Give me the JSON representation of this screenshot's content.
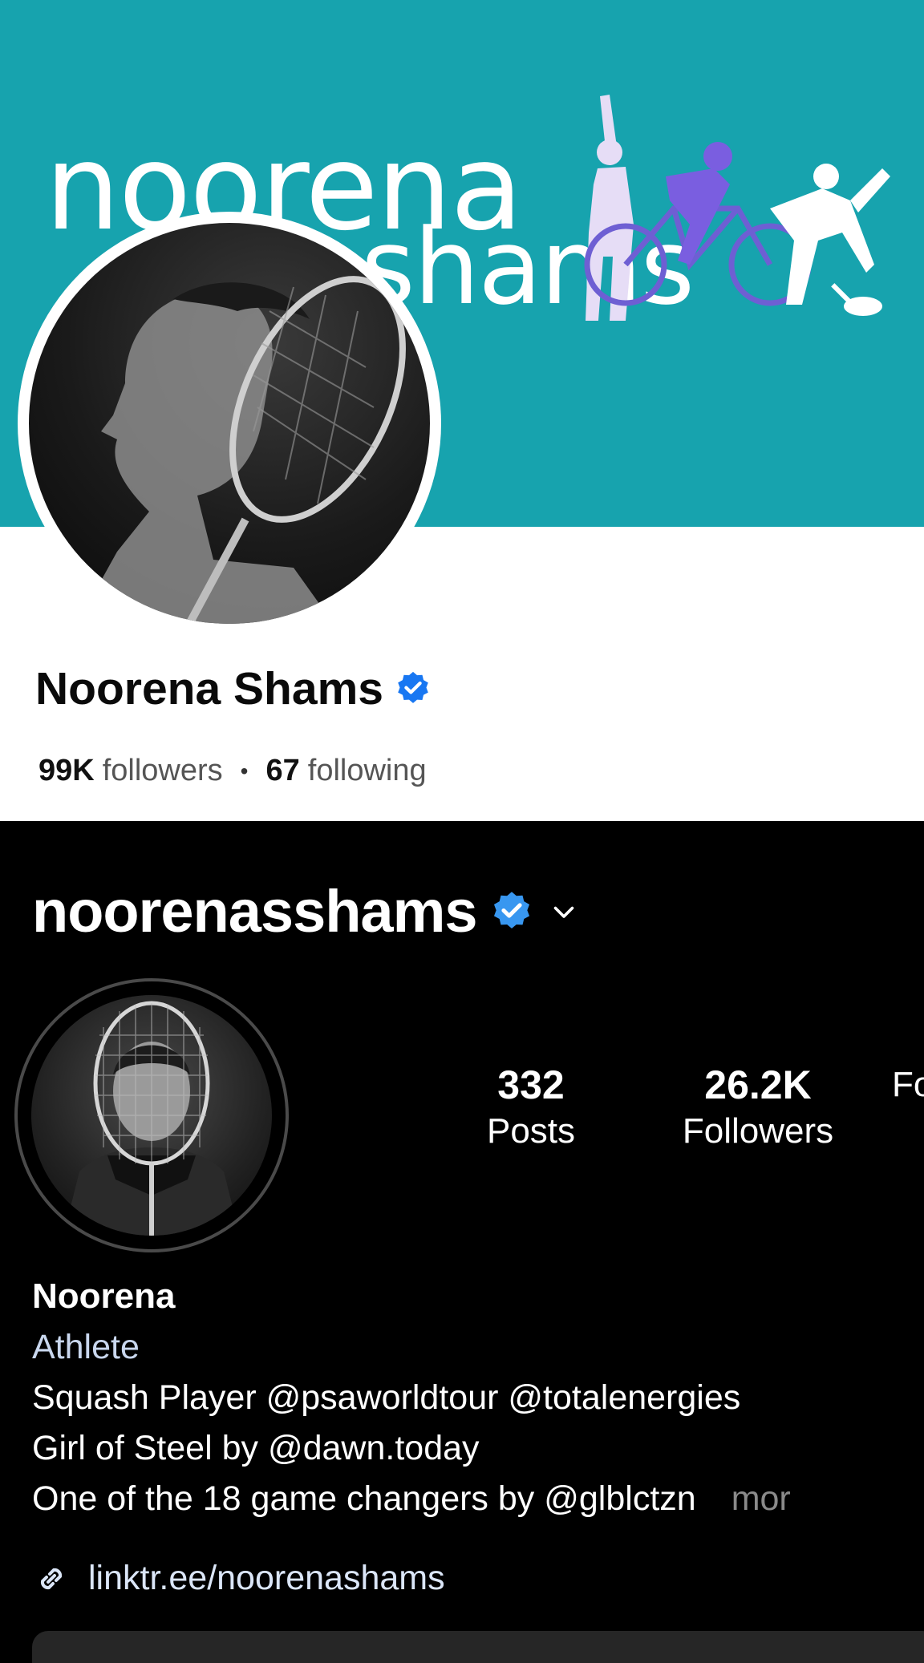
{
  "facebook": {
    "cover_logo": {
      "line1": "noorena",
      "line2": "shams"
    },
    "name": "Noorena Shams",
    "verified_icon": "verified-badge-icon",
    "followers_count": "99K",
    "followers_label": "followers",
    "separator": "•",
    "following_count": "67",
    "following_label": "following",
    "colors": {
      "cover": "#17a3ae",
      "badge": "#1877f2"
    }
  },
  "instagram": {
    "handle": "noorenasshams",
    "verified_icon": "verified-badge-icon",
    "dropdown_icon": "chevron-down-icon",
    "stats": [
      {
        "count": "332",
        "label": "Posts"
      },
      {
        "count": "26.2K",
        "label": "Followers"
      },
      {
        "count": "",
        "label": "Fo"
      }
    ],
    "bio": {
      "name": "Noorena",
      "category": "Athlete",
      "lines": [
        "Squash Player @psaworldtour @totalenergies",
        "Girl of Steel by @dawn.today",
        "One of the 18 game changers by @glblctzn"
      ],
      "more": "mor"
    },
    "link_icon": "link-icon",
    "link": "linktr.ee/noorenashams",
    "colors": {
      "badge": "#3897f0"
    }
  }
}
